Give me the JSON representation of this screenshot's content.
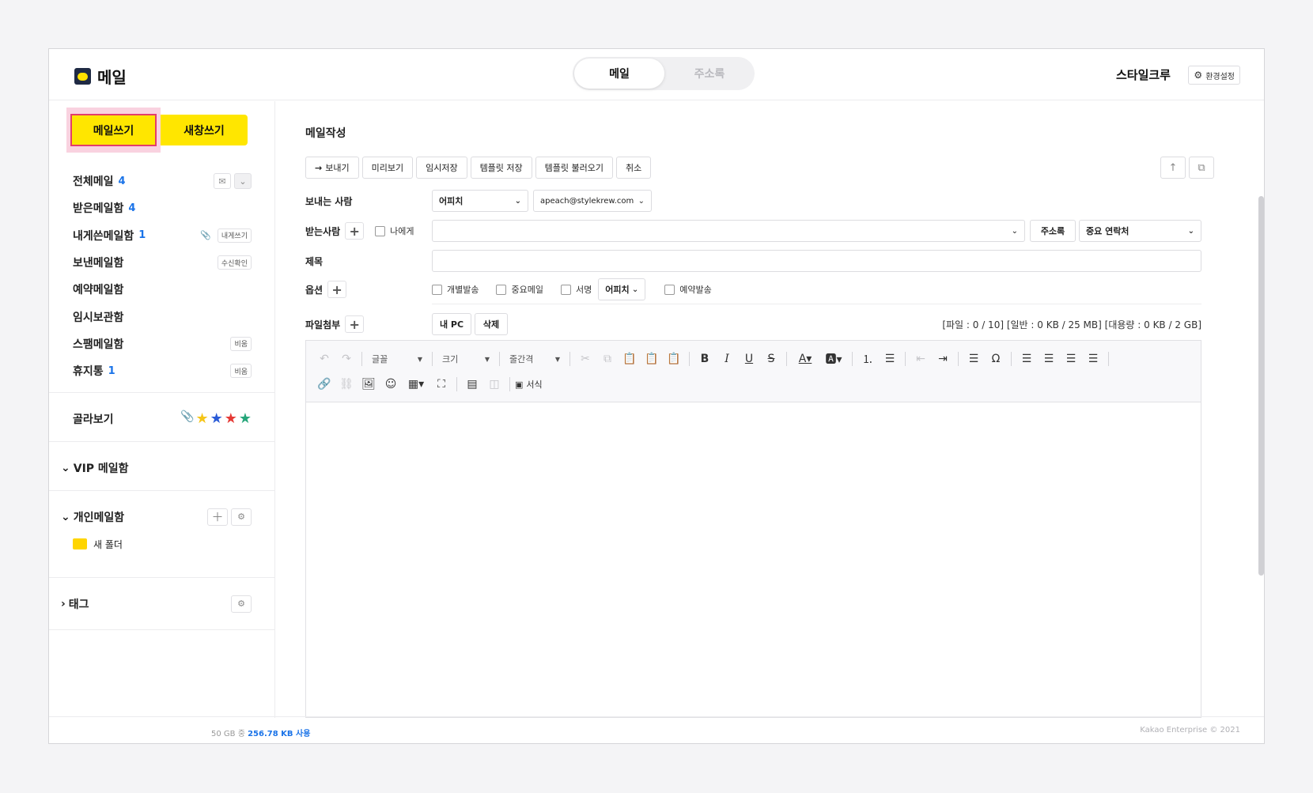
{
  "app": {
    "title": "메일",
    "logo_icon": "mail-logo-icon"
  },
  "top_tabs": [
    {
      "label": "메일"
    },
    {
      "label": "주소록"
    }
  ],
  "header": {
    "user_name": "스타일크루",
    "settings_label": "환경설정"
  },
  "sidebar": {
    "compose_label": "메일쓰기",
    "new_window_label": "새창쓰기",
    "folders": [
      {
        "label": "전체메일",
        "count": "4"
      },
      {
        "label": "받은메일함",
        "count": "4"
      },
      {
        "label": "내게쓴메일함",
        "count": "1",
        "chip": "내게쓰기"
      },
      {
        "label": "보낸메일함",
        "count": "",
        "chip": "수신확인"
      },
      {
        "label": "예약메일함",
        "count": ""
      },
      {
        "label": "임시보관함",
        "count": ""
      },
      {
        "label": "스팸메일함",
        "count": "",
        "chip": "비움"
      },
      {
        "label": "휴지통",
        "count": "1",
        "chip": "비움"
      }
    ],
    "filter_label": "골라보기",
    "vip_label": "VIP 메일함",
    "personal_label": "개인메일함",
    "new_folder_label": "새 폴더",
    "tag_label": "태그",
    "storage_prefix": "50 GB 중",
    "storage_used": "256.78 KB 사용"
  },
  "compose": {
    "title": "메일작성",
    "toolbar": {
      "send": "보내기",
      "preview": "미리보기",
      "draft": "임시저장",
      "save_template": "템플릿 저장",
      "load_template": "템플릿 불러오기",
      "cancel": "취소"
    },
    "sender_label": "보내는 사람",
    "sender_name": "어피치",
    "sender_email": "apeach@stylekrew.com",
    "recipient_label": "받는사람",
    "to_me_label": "나에게",
    "address_book_label": "주소록",
    "important_contacts_label": "중요 연락처",
    "subject_label": "제목",
    "options_label": "옵션",
    "opt_individual": "개별발송",
    "opt_important": "중요메일",
    "opt_signature": "서명",
    "signature_select": "어피치",
    "opt_scheduled": "예약발송",
    "attach_label": "파일첨부",
    "my_pc_label": "내 PC",
    "delete_label": "삭제",
    "attach_info": "[파일 : 0 / 10] [일반 : 0 KB / 25 MB] [대용량 : 0 KB / 2 GB]"
  },
  "editor": {
    "font_label": "글꼴",
    "size_label": "크기",
    "line_height_label": "줄간격",
    "format_label": "서식"
  },
  "footer": {
    "copyright": "Kakao Enterprise © 2021"
  },
  "colors": {
    "accent": "#ffe600",
    "highlight": "#e33d6b",
    "link": "#1a73e8"
  }
}
